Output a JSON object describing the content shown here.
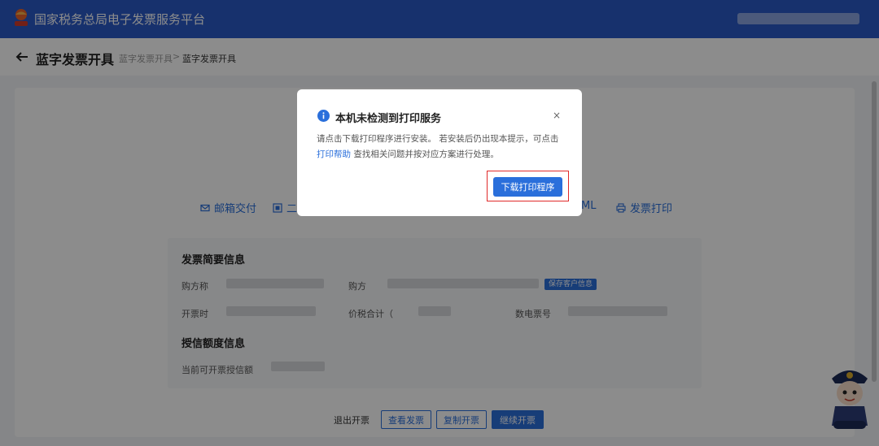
{
  "header": {
    "title": "国家税务总局电子发票服务平台"
  },
  "breadcrumb": {
    "page_title": "蓝字发票开具",
    "crumb1": "蓝字发票开具",
    "separator": ">",
    "crumb2": "蓝字发票开具"
  },
  "actions": {
    "email": "邮箱交付",
    "qr": "二",
    "xml": "ML",
    "print": "发票打印"
  },
  "summary": {
    "title": "发票简要信息",
    "buyer_name_label": "购方称",
    "buyer_tax_label": "购方",
    "save_customer": "保存客户信息",
    "issue_time_label": "开票时",
    "total_label": "价税合计（",
    "number_label": "数电票号"
  },
  "credit": {
    "title": "授信额度信息",
    "available_label": "当前可开票授信额"
  },
  "footer_buttons": {
    "exit": "退出开票",
    "view": "查看发票",
    "copy": "复制开票",
    "continue": "继续开票"
  },
  "modal": {
    "title": "本机未检测到打印服务",
    "close": "×",
    "body_pre": "请点击下载打印程序进行安装。 若安装后仍出现本提示，可点击 ",
    "body_link": "打印帮助",
    "body_post": " 查找相关问题并按对应方案进行处理。",
    "download_button": "下载打印程序"
  },
  "colors": {
    "header_blue": "#2a59c7",
    "accent_blue": "#2a6fdb",
    "highlight_red": "#e02a2a"
  }
}
